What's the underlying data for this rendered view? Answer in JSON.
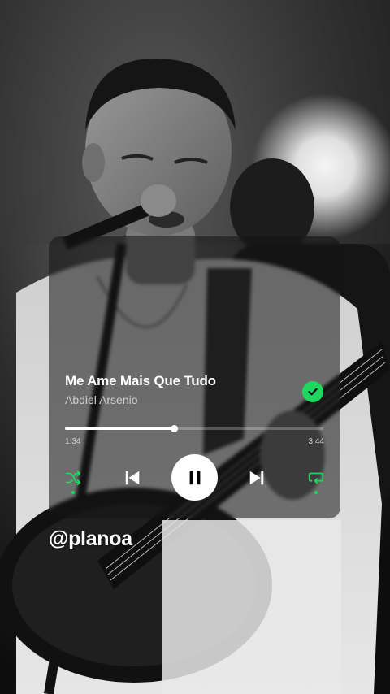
{
  "track": {
    "title": "Me Ame Mais Que Tudo",
    "artist": "Abdiel Arsenio",
    "saved": true
  },
  "playback": {
    "elapsed": "1:34",
    "total": "3:44",
    "progress": 0.42,
    "state": "playing",
    "shuffle": true,
    "repeat": true
  },
  "overlay": {
    "handle": "@planoa"
  },
  "icons": {
    "saved": "check-circle-icon",
    "shuffle": "shuffle-icon",
    "prev": "skip-previous-icon",
    "play": "pause-icon",
    "next": "skip-next-icon",
    "repeat": "repeat-icon"
  },
  "colors": {
    "accent": "#1ed760",
    "text": "#ffffff",
    "muted": "#cfcfcf",
    "card": "rgba(20,20,20,0.55)"
  }
}
